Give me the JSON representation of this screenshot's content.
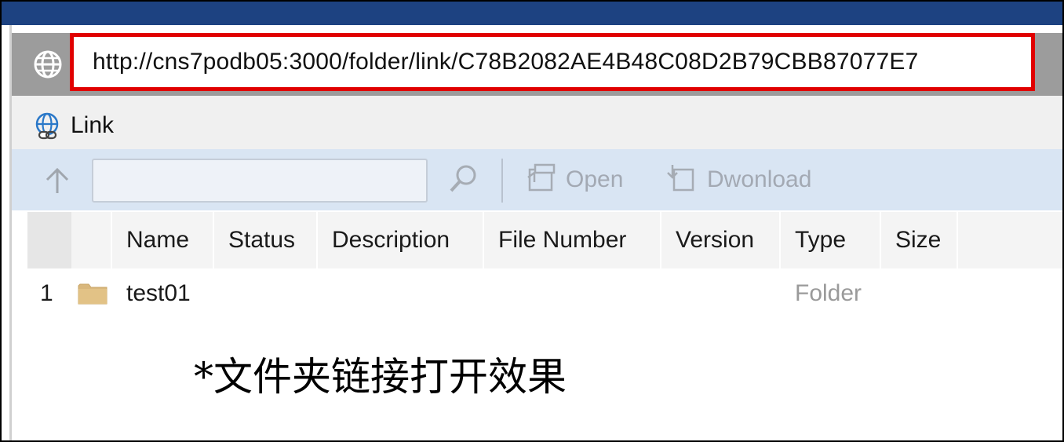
{
  "address_bar": {
    "url": "http://cns7podb05:3000/folder/link/C78B2082AE4B48C08D2B79CBB87077E7",
    "icon": "globe-icon",
    "highlight_color": "#e00000"
  },
  "window": {
    "title_bar_color": "#1d4281"
  },
  "panel": {
    "title": "Link",
    "icon": "link-globe-icon"
  },
  "toolbar": {
    "up_icon": "arrow-up-icon",
    "search_value": "",
    "search_icon": "search-icon",
    "open_label": "Open",
    "download_label": "Dwonload"
  },
  "grid": {
    "columns": [
      "Name",
      "Status",
      "Description",
      "File Number",
      "Version",
      "Type",
      "Size"
    ],
    "rows": [
      {
        "index": "1",
        "icon": "folder-icon",
        "name": "test01",
        "status": "",
        "description": "",
        "file_number": "",
        "version": "",
        "type": "Folder",
        "size": ""
      }
    ]
  },
  "caption": "*文件夹链接打开效果"
}
